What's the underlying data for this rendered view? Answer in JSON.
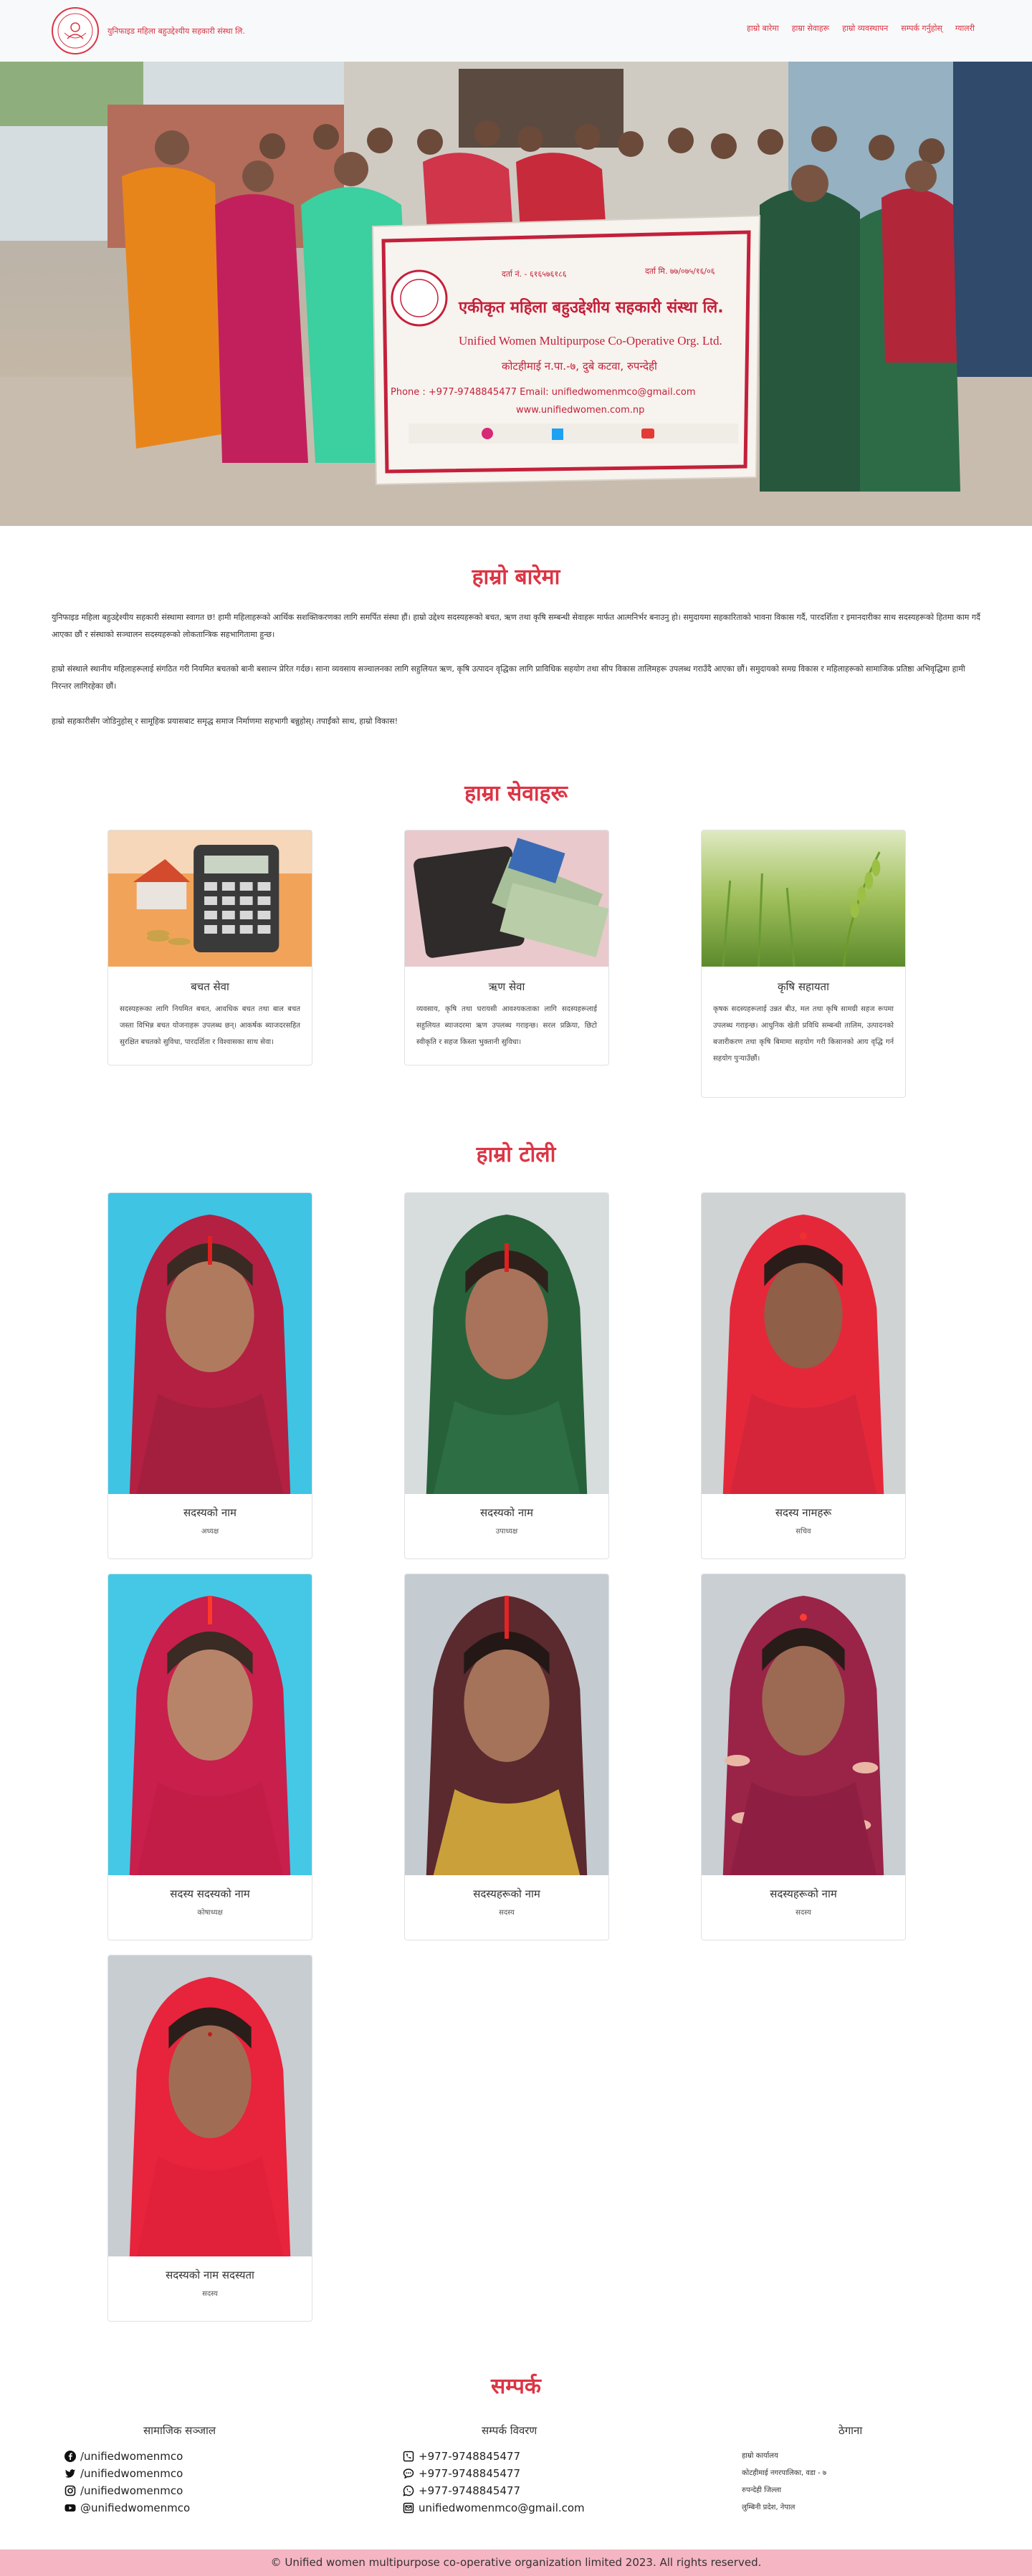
{
  "header": {
    "org_name": "युनिफाइड महिला बहुउद्देश्यीय सहकारी संस्था लि.",
    "nav": [
      "हाम्रो बारेमा",
      "हाम्रा सेवाहरू",
      "हाम्रो व्यवस्थापन",
      "सम्पर्क गर्नुहोस्",
      "ग्यालरी"
    ]
  },
  "hero": {
    "banner_reg": "दर्ता नं. - ६१६५७६१८६",
    "banner_date": "दर्ता मि. ७७/०७५/१६/०६",
    "banner_title_np": "एकीकृत महिला बहुउद्देशीय सहकारी संस्था लि.",
    "banner_title_en": "Unified Women Multipurpose Co-Operative Org. Ltd.",
    "banner_address": "कोटहीमाई न.पा.-७, दुबे कटवा, रुपन्देही",
    "banner_phone": "Phone : +977-9748845477  Email: unifiedwomenmco@gmail.com",
    "banner_web": "www.unifiedwomen.com.np"
  },
  "about": {
    "title": "हाम्रो बारेमा",
    "paragraphs": [
      "युनिफाइड महिला बहुउद्देश्यीय सहकारी संस्थामा स्वागत छ! हामी महिलाहरूको आर्थिक सशक्तिकरणका लागि समर्पित संस्था हौं। हाम्रो उद्देश्य सदस्यहरूको बचत, ऋण तथा कृषि सम्बन्धी सेवाहरू मार्फत आत्मनिर्भर बनाउनु हो। समुदायमा सहकारिताको भावना विकास गर्दै, पारदर्शिता र इमानदारीका साथ सदस्यहरूको हितमा काम गर्दै आएका छौं र संस्थाको सञ्चालन सदस्यहरूको लोकतान्त्रिक सहभागितामा हुन्छ।",
      "हाम्रो संस्थाले स्थानीय महिलाहरूलाई संगठित गरी नियमित बचतको बानी बसाल्न प्रेरित गर्दछ। साना व्यवसाय सञ्चालनका लागि सहुलियत ऋण, कृषि उत्पादन वृद्धिका लागि प्राविधिक सहयोग तथा सीप विकास तालिमहरू उपलब्ध गराउँदै आएका छौं। समुदायको समग्र विकास र महिलाहरूको सामाजिक प्रतिष्ठा अभिवृद्धिमा हामी निरन्तर लागिरहेका छौं।",
      "हाम्रो सहकारीसँग जोडिनुहोस् र सामूहिक प्रयासबाट समृद्ध समाज निर्माणमा सहभागी बन्नुहोस्। तपाईंको साथ, हाम्रो विकास!"
    ]
  },
  "services": {
    "title": "हाम्रा सेवाहरू",
    "items": [
      {
        "title": "बचत सेवा",
        "text": "सदस्यहरूका लागि नियमित बचत, आवधिक बचत तथा बाल बचत जस्ता विभिन्न बचत योजनाहरू उपलब्ध छन्। आकर्षक ब्याजदरसहित सुरक्षित बचतको सुविधा, पारदर्शिता र विश्वासका साथ सेवा।"
      },
      {
        "title": "ऋण सेवा",
        "text": "व्यवसाय, कृषि तथा घरायसी आवश्यकताका लागि सदस्यहरूलाई सहुलियत ब्याजदरमा ऋण उपलब्ध गराइन्छ। सरल प्रक्रिया, छिटो स्वीकृति र सहज किस्ता भुक्तानी सुविधा।"
      },
      {
        "title": "कृषि सहायता",
        "text": "कृषक सदस्यहरूलाई उन्नत बीउ, मल तथा कृषि सामग्री सहज रूपमा उपलब्ध गराइन्छ। आधुनिक खेती प्रविधि सम्बन्धी तालिम, उत्पादनको बजारीकरण तथा कृषि बिमामा सहयोग गरी किसानको आय वृद्धि गर्न सहयोग पुर्‍याउँछौं।"
      }
    ]
  },
  "team": {
    "title": "हाम्रो टोली",
    "members": [
      {
        "name": "सदस्यको नाम",
        "role": "अध्यक्ष"
      },
      {
        "name": "सदस्यको नाम",
        "role": "उपाध्यक्ष"
      },
      {
        "name": "सदस्य नामहरू",
        "role": "सचिव"
      },
      {
        "name": "सदस्य सदस्यको नाम",
        "role": "कोषाध्यक्ष"
      },
      {
        "name": "सदस्यहरूको नाम",
        "role": "सदस्य"
      },
      {
        "name": "सदस्यहरूको नाम",
        "role": "सदस्य"
      },
      {
        "name": "सदस्यको नाम सदस्यता",
        "role": "सदस्य"
      }
    ]
  },
  "contact": {
    "title": "सम्पर्क",
    "social_title": "सामाजिक सञ्जाल",
    "social": [
      {
        "icon": "facebook-icon",
        "text": "/unifiedwomenmco"
      },
      {
        "icon": "twitter-icon",
        "text": "/unifiedwomenmco"
      },
      {
        "icon": "instagram-icon",
        "text": "/unifiedwomenmco"
      },
      {
        "icon": "youtube-icon",
        "text": "@unifiedwomenmco"
      }
    ],
    "phone_title": "सम्पर्क विवरण",
    "phones": [
      {
        "icon": "phone-icon",
        "text": "+977-9748845477"
      },
      {
        "icon": "chat-icon",
        "text": "+977-9748845477"
      },
      {
        "icon": "whatsapp-icon",
        "text": "+977-9748845477"
      },
      {
        "icon": "email-icon",
        "text": "unifiedwomenmco@gmail.com"
      }
    ],
    "address_title": "ठेगाना",
    "address": [
      "हाम्रो कार्यालय",
      "कोटहीमाई नगरपालिका, वडा - ७",
      "रुपन्देही जिल्ला",
      "लुम्बिनी प्रदेश, नेपाल"
    ]
  },
  "footer": {
    "copyright": "© Unified women multipurpose co-operative organization limited 2023. All rights reserved."
  },
  "colors": {
    "accent": "#dc3545",
    "footer_bg": "#f5b5c3"
  }
}
